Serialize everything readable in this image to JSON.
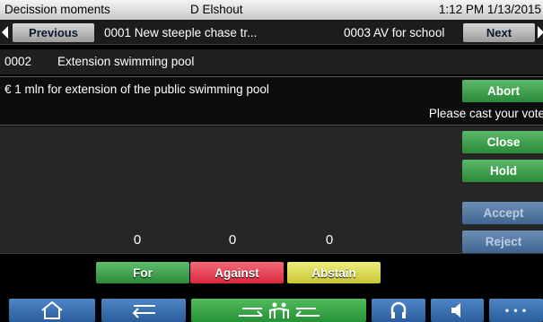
{
  "status_bar": {
    "app_title": "Decission moments",
    "user": "D Elshout",
    "datetime": "1:12 PM 1/13/2015"
  },
  "navigation": {
    "previous_label": "Previous",
    "previous_item": "0001 New steeple chase tr...",
    "next_item": "0003 AV for school",
    "next_label": "Next"
  },
  "motion": {
    "number": "0002",
    "title": "Extension swimming pool",
    "description": "€ 1 mln for extension of the public swimming pool",
    "instruction": "Please cast your vote"
  },
  "vote_counts": {
    "for": "0",
    "against": "0",
    "abstain": "0"
  },
  "side_buttons": {
    "abort": "Abort",
    "close": "Close",
    "hold": "Hold",
    "accept": "Accept",
    "reject": "Reject"
  },
  "vote_buttons": {
    "for": "For",
    "against": "Against",
    "abstain": "Abstain"
  },
  "toolbar": {
    "home": "home-icon",
    "back": "back-arrow-icon",
    "interpretation": "interpreter-exchange-icon",
    "headphones": "headphones-icon",
    "speaker": "speaker-icon",
    "more": "more-icon",
    "more_glyph": "• • •"
  }
}
